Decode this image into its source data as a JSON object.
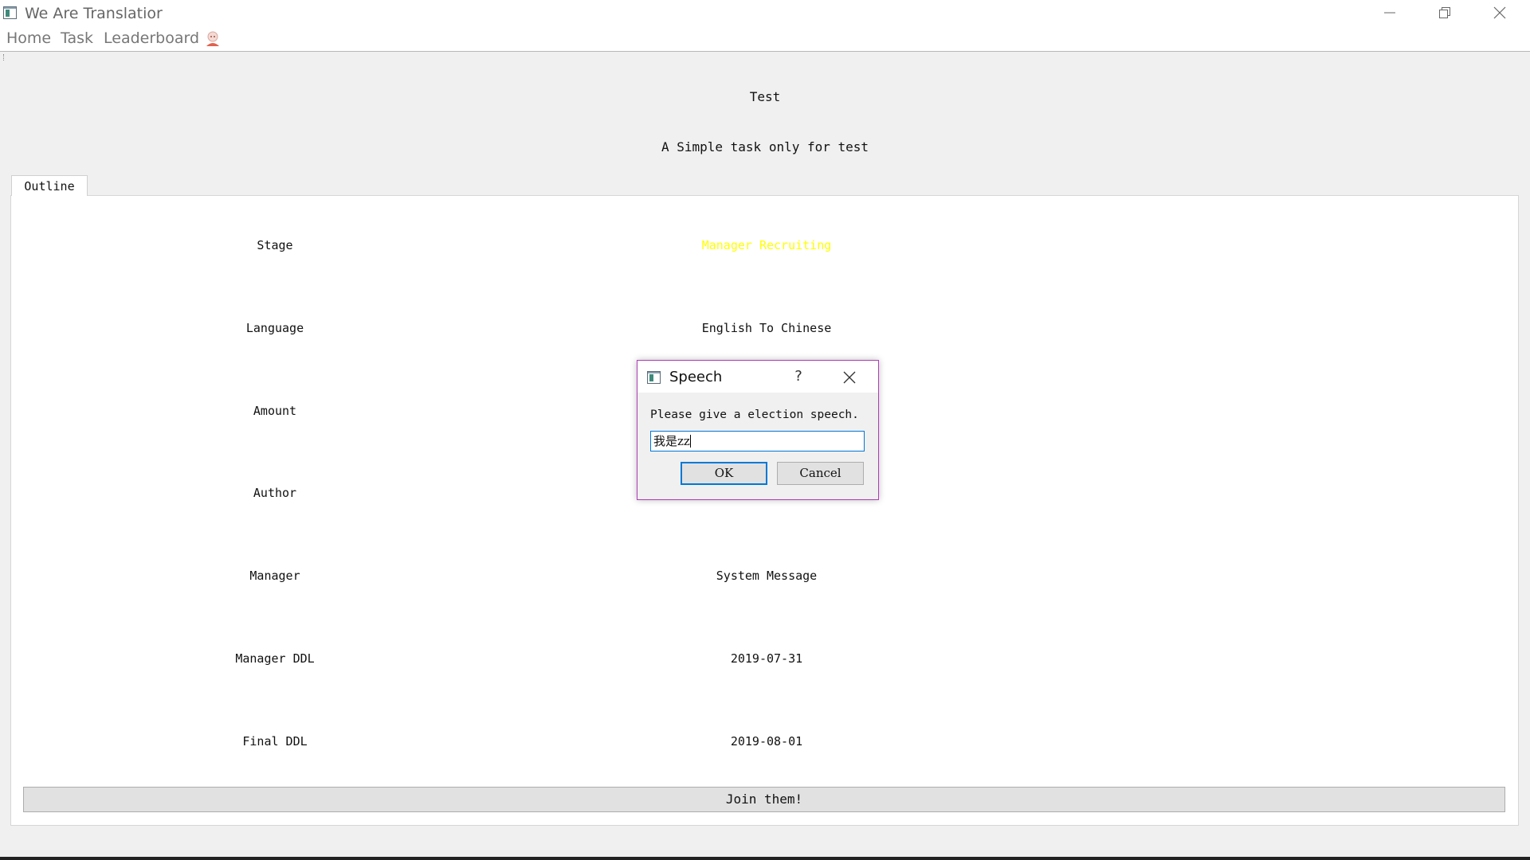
{
  "window": {
    "title": "We Are Translatior",
    "icons": {
      "app": "app-window-icon",
      "minimize": "minimize-icon",
      "maximize": "restore-icon",
      "close": "close-icon"
    }
  },
  "menu": {
    "items": [
      {
        "label": "Home"
      },
      {
        "label": "Task"
      },
      {
        "label": "Leaderboard"
      }
    ],
    "avatar_icon": "avatar-icon"
  },
  "task": {
    "title": "Test",
    "description": "A Simple task only for test"
  },
  "tabs": [
    {
      "label": "Outline",
      "active": true
    }
  ],
  "outline": {
    "rows": [
      {
        "label": "Stage",
        "value": "Manager Recruiting"
      },
      {
        "label": "Language",
        "value": "English To Chinese"
      },
      {
        "label": "Amount",
        "value": ""
      },
      {
        "label": "Author",
        "value": ""
      },
      {
        "label": "Manager",
        "value": "System Message"
      },
      {
        "label": "Manager DDL",
        "value": "2019-07-31"
      },
      {
        "label": "Final DDL",
        "value": "2019-08-01"
      }
    ],
    "stage_color": "#ffff00"
  },
  "join_button": {
    "label": "Join them!"
  },
  "dialog": {
    "title": "Speech",
    "help_label": "?",
    "prompt": "Please give a election speech.",
    "input_value": "我是zz",
    "ok_label": "OK",
    "cancel_label": "Cancel",
    "border_color": "#b03cb8",
    "focus_color": "#0078d7"
  }
}
